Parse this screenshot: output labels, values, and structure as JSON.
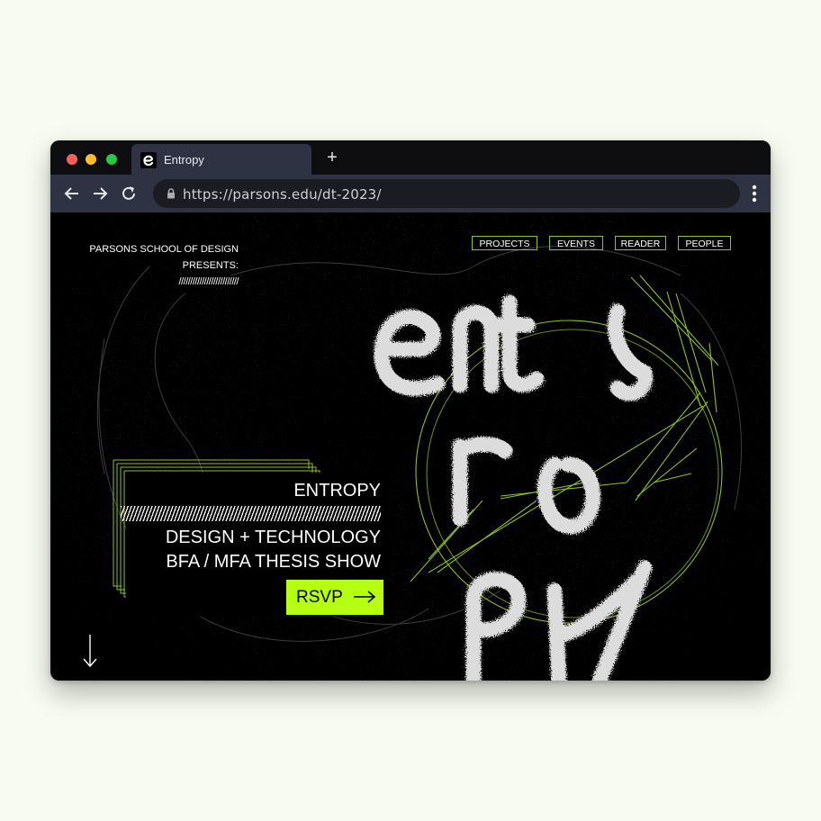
{
  "browser": {
    "tab_title": "Entropy",
    "new_tab_icon": "+",
    "url": "https://parsons.edu/dt-2023/"
  },
  "site": {
    "presents_line1": "PARSONS SCHOOL OF DESIGN",
    "presents_line2": "PRESENTS:",
    "presents_slashes": "//////////////////////////",
    "nav": [
      "PROJECTS",
      "EVENTS",
      "READER",
      "PEOPLE"
    ],
    "hero_title": "ENTROPY",
    "hero_line2": "DESIGN + TECHNOLOGY",
    "hero_line3": "BFA / MFA THESIS SHOW",
    "rsvp_label": "RSVP",
    "logo_text": "entropy"
  },
  "colors": {
    "accent": "#b5ff12",
    "nav_border": "#8fbf2a",
    "page_bg": "#000000",
    "toolbar": "#2f3242"
  },
  "icons": [
    "back-arrow-icon",
    "forward-arrow-icon",
    "reload-icon",
    "lock-icon",
    "kebab-menu-icon",
    "right-arrow-icon",
    "down-arrow-icon"
  ]
}
